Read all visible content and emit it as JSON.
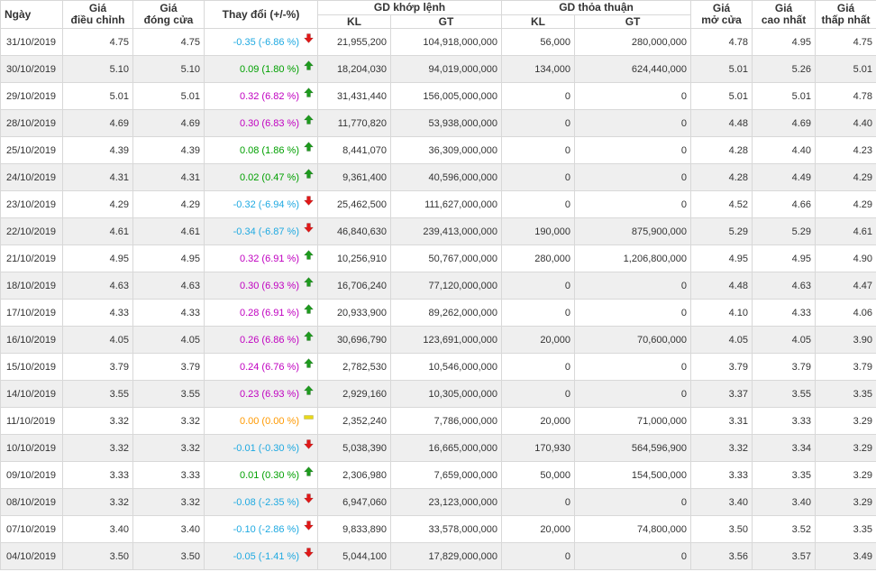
{
  "colors": {
    "up": "#00a000",
    "down": "#1ea9e1",
    "ceiling": "#c000c0",
    "ref": "#ff9900",
    "up_arrow": "#1e9a1e",
    "down_arrow": "#e01818",
    "ref_marker": "#e8d81a"
  },
  "headers": {
    "date": "Ngày",
    "adjusted": [
      "Giá",
      "điều chỉnh"
    ],
    "close": [
      "Giá",
      "đóng cửa"
    ],
    "change": "Thay đổi (+/-%)",
    "matched": "GD khớp lệnh",
    "negotiated": "GD thỏa thuận",
    "kl": "KL",
    "gt": "GT",
    "open": [
      "Giá",
      "mở cửa"
    ],
    "high": [
      "Giá",
      "cao nhất"
    ],
    "low": [
      "Giá",
      "thấp nhất"
    ]
  },
  "rows": [
    {
      "date": "31/10/2019",
      "adj": "4.75",
      "close": "4.75",
      "change": "-0.35 (-6.86 %)",
      "trend": "down",
      "kl": "21,955,200",
      "gt": "104,918,000,000",
      "tt_kl": "56,000",
      "tt_gt": "280,000,000",
      "open": "4.78",
      "high": "4.95",
      "low": "4.75"
    },
    {
      "date": "30/10/2019",
      "adj": "5.10",
      "close": "5.10",
      "change": "0.09 (1.80 %)",
      "trend": "up",
      "kl": "18,204,030",
      "gt": "94,019,000,000",
      "tt_kl": "134,000",
      "tt_gt": "624,440,000",
      "open": "5.01",
      "high": "5.26",
      "low": "5.01"
    },
    {
      "date": "29/10/2019",
      "adj": "5.01",
      "close": "5.01",
      "change": "0.32 (6.82 %)",
      "trend": "ceiling",
      "kl": "31,431,440",
      "gt": "156,005,000,000",
      "tt_kl": "0",
      "tt_gt": "0",
      "open": "5.01",
      "high": "5.01",
      "low": "4.78"
    },
    {
      "date": "28/10/2019",
      "adj": "4.69",
      "close": "4.69",
      "change": "0.30 (6.83 %)",
      "trend": "ceiling",
      "kl": "11,770,820",
      "gt": "53,938,000,000",
      "tt_kl": "0",
      "tt_gt": "0",
      "open": "4.48",
      "high": "4.69",
      "low": "4.40"
    },
    {
      "date": "25/10/2019",
      "adj": "4.39",
      "close": "4.39",
      "change": "0.08 (1.86 %)",
      "trend": "up",
      "kl": "8,441,070",
      "gt": "36,309,000,000",
      "tt_kl": "0",
      "tt_gt": "0",
      "open": "4.28",
      "high": "4.40",
      "low": "4.23"
    },
    {
      "date": "24/10/2019",
      "adj": "4.31",
      "close": "4.31",
      "change": "0.02 (0.47 %)",
      "trend": "up",
      "kl": "9,361,400",
      "gt": "40,596,000,000",
      "tt_kl": "0",
      "tt_gt": "0",
      "open": "4.28",
      "high": "4.49",
      "low": "4.29"
    },
    {
      "date": "23/10/2019",
      "adj": "4.29",
      "close": "4.29",
      "change": "-0.32 (-6.94 %)",
      "trend": "down",
      "kl": "25,462,500",
      "gt": "111,627,000,000",
      "tt_kl": "0",
      "tt_gt": "0",
      "open": "4.52",
      "high": "4.66",
      "low": "4.29"
    },
    {
      "date": "22/10/2019",
      "adj": "4.61",
      "close": "4.61",
      "change": "-0.34 (-6.87 %)",
      "trend": "down",
      "kl": "46,840,630",
      "gt": "239,413,000,000",
      "tt_kl": "190,000",
      "tt_gt": "875,900,000",
      "open": "5.29",
      "high": "5.29",
      "low": "4.61"
    },
    {
      "date": "21/10/2019",
      "adj": "4.95",
      "close": "4.95",
      "change": "0.32 (6.91 %)",
      "trend": "ceiling",
      "kl": "10,256,910",
      "gt": "50,767,000,000",
      "tt_kl": "280,000",
      "tt_gt": "1,206,800,000",
      "open": "4.95",
      "high": "4.95",
      "low": "4.90"
    },
    {
      "date": "18/10/2019",
      "adj": "4.63",
      "close": "4.63",
      "change": "0.30 (6.93 %)",
      "trend": "ceiling",
      "kl": "16,706,240",
      "gt": "77,120,000,000",
      "tt_kl": "0",
      "tt_gt": "0",
      "open": "4.48",
      "high": "4.63",
      "low": "4.47"
    },
    {
      "date": "17/10/2019",
      "adj": "4.33",
      "close": "4.33",
      "change": "0.28 (6.91 %)",
      "trend": "ceiling",
      "kl": "20,933,900",
      "gt": "89,262,000,000",
      "tt_kl": "0",
      "tt_gt": "0",
      "open": "4.10",
      "high": "4.33",
      "low": "4.06"
    },
    {
      "date": "16/10/2019",
      "adj": "4.05",
      "close": "4.05",
      "change": "0.26 (6.86 %)",
      "trend": "ceiling",
      "kl": "30,696,790",
      "gt": "123,691,000,000",
      "tt_kl": "20,000",
      "tt_gt": "70,600,000",
      "open": "4.05",
      "high": "4.05",
      "low": "3.90"
    },
    {
      "date": "15/10/2019",
      "adj": "3.79",
      "close": "3.79",
      "change": "0.24 (6.76 %)",
      "trend": "ceiling",
      "kl": "2,782,530",
      "gt": "10,546,000,000",
      "tt_kl": "0",
      "tt_gt": "0",
      "open": "3.79",
      "high": "3.79",
      "low": "3.79"
    },
    {
      "date": "14/10/2019",
      "adj": "3.55",
      "close": "3.55",
      "change": "0.23 (6.93 %)",
      "trend": "ceiling",
      "kl": "2,929,160",
      "gt": "10,305,000,000",
      "tt_kl": "0",
      "tt_gt": "0",
      "open": "3.37",
      "high": "3.55",
      "low": "3.35"
    },
    {
      "date": "11/10/2019",
      "adj": "3.32",
      "close": "3.32",
      "change": "0.00 (0.00 %)",
      "trend": "ref",
      "kl": "2,352,240",
      "gt": "7,786,000,000",
      "tt_kl": "20,000",
      "tt_gt": "71,000,000",
      "open": "3.31",
      "high": "3.33",
      "low": "3.29"
    },
    {
      "date": "10/10/2019",
      "adj": "3.32",
      "close": "3.32",
      "change": "-0.01 (-0.30 %)",
      "trend": "down",
      "kl": "5,038,390",
      "gt": "16,665,000,000",
      "tt_kl": "170,930",
      "tt_gt": "564,596,900",
      "open": "3.32",
      "high": "3.34",
      "low": "3.29"
    },
    {
      "date": "09/10/2019",
      "adj": "3.33",
      "close": "3.33",
      "change": "0.01 (0.30 %)",
      "trend": "up",
      "kl": "2,306,980",
      "gt": "7,659,000,000",
      "tt_kl": "50,000",
      "tt_gt": "154,500,000",
      "open": "3.33",
      "high": "3.35",
      "low": "3.29"
    },
    {
      "date": "08/10/2019",
      "adj": "3.32",
      "close": "3.32",
      "change": "-0.08 (-2.35 %)",
      "trend": "down",
      "kl": "6,947,060",
      "gt": "23,123,000,000",
      "tt_kl": "0",
      "tt_gt": "0",
      "open": "3.40",
      "high": "3.40",
      "low": "3.29"
    },
    {
      "date": "07/10/2019",
      "adj": "3.40",
      "close": "3.40",
      "change": "-0.10 (-2.86 %)",
      "trend": "down",
      "kl": "9,833,890",
      "gt": "33,578,000,000",
      "tt_kl": "20,000",
      "tt_gt": "74,800,000",
      "open": "3.50",
      "high": "3.52",
      "low": "3.35"
    },
    {
      "date": "04/10/2019",
      "adj": "3.50",
      "close": "3.50",
      "change": "-0.05 (-1.41 %)",
      "trend": "down",
      "kl": "5,044,100",
      "gt": "17,829,000,000",
      "tt_kl": "0",
      "tt_gt": "0",
      "open": "3.56",
      "high": "3.57",
      "low": "3.49"
    }
  ]
}
